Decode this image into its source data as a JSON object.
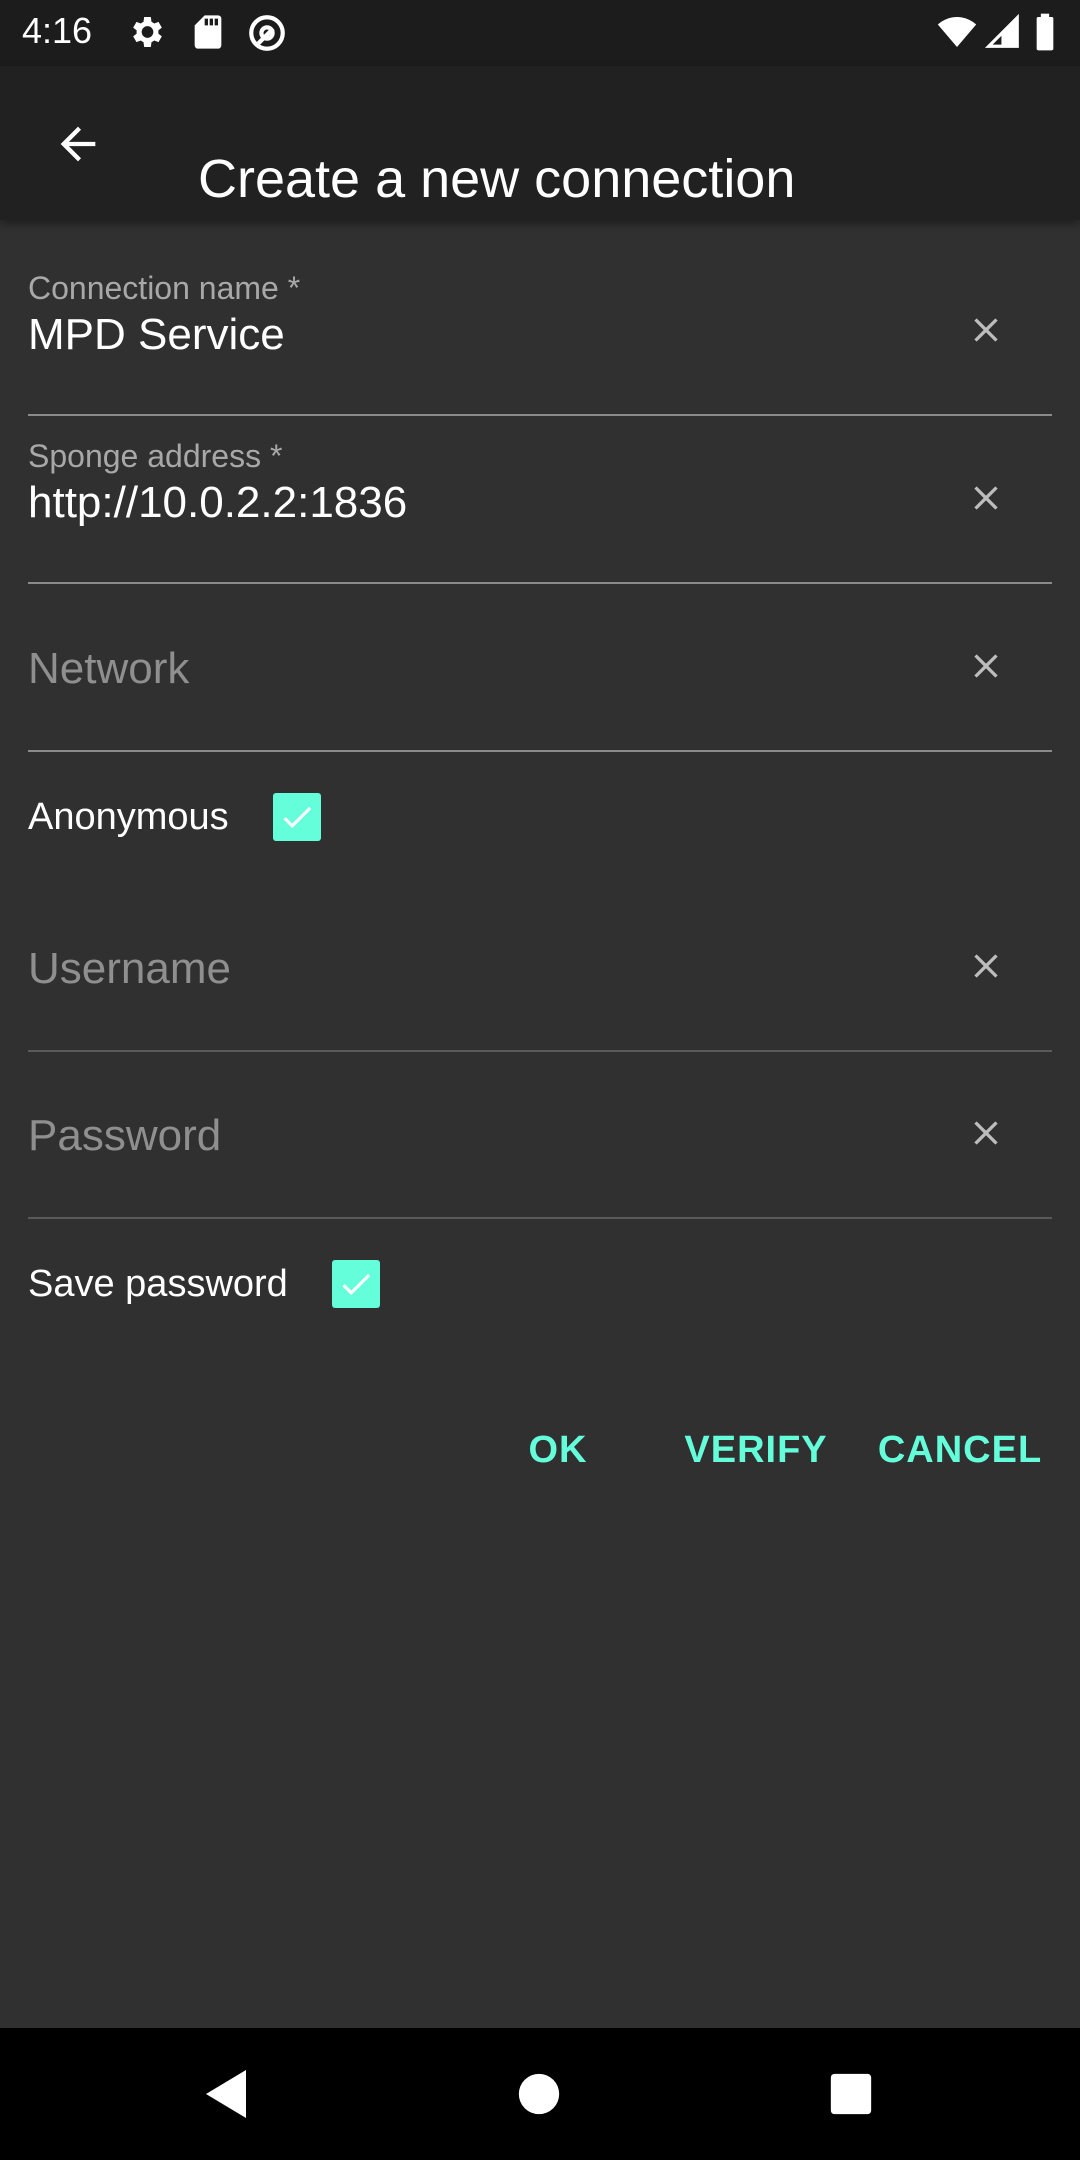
{
  "status_bar": {
    "time": "4:16",
    "left_icons": [
      "gear-icon",
      "sd-card-icon",
      "at-sign-icon"
    ],
    "right_icons": [
      "wifi-icon",
      "cell-signal-icon",
      "battery-icon"
    ]
  },
  "app_bar": {
    "back_icon": "arrow-left-icon",
    "title": "Create a new connection"
  },
  "form": {
    "connection_name": {
      "label": "Connection name *",
      "value": "MPD Service",
      "placeholder": ""
    },
    "sponge_address": {
      "label": "Sponge address *",
      "value": "http://10.0.2.2:1836",
      "placeholder": ""
    },
    "network": {
      "label": "",
      "value": "",
      "placeholder": "Network"
    },
    "anonymous": {
      "label": "Anonymous",
      "checked": true
    },
    "username": {
      "label": "",
      "value": "",
      "placeholder": "Username"
    },
    "password": {
      "label": "",
      "value": "",
      "placeholder": "Password"
    },
    "save_password": {
      "label": "Save password",
      "checked": true
    }
  },
  "actions": {
    "ok": "OK",
    "verify": "VERIFY",
    "cancel": "CANCEL"
  },
  "colors": {
    "accent": "#64ffda",
    "background": "#303030",
    "app_bar": "#212121"
  },
  "nav_bar": {
    "icons": [
      "back-triangle-icon",
      "home-circle-icon",
      "recents-square-icon"
    ]
  }
}
